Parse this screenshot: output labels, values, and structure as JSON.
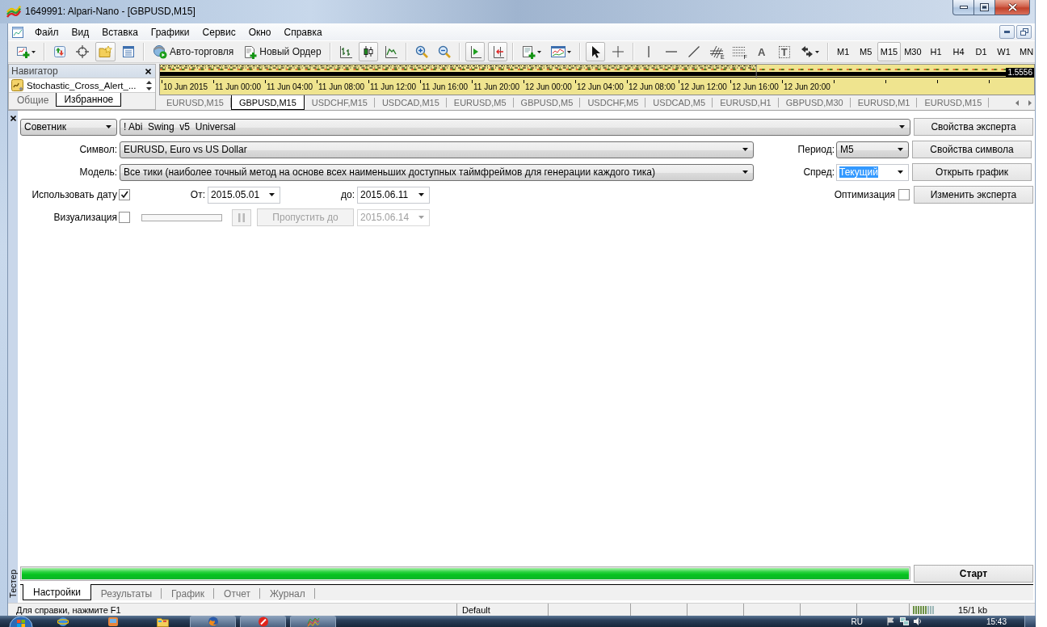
{
  "window": {
    "title": "1649991: Alpari-Nano - [GBPUSD,M15]"
  },
  "menu": [
    "Файл",
    "Вид",
    "Вставка",
    "Графики",
    "Сервис",
    "Окно",
    "Справка"
  ],
  "toolbar": {
    "groups": [
      [
        {
          "kind": "new-chart",
          "pressed": false,
          "dropdown": true
        }
      ],
      [
        {
          "kind": "market-watch",
          "pressed": false
        },
        {
          "kind": "data-window",
          "pressed": false
        },
        {
          "kind": "navigator",
          "pressed": true
        },
        {
          "kind": "terminal",
          "pressed": false
        }
      ],
      [
        {
          "kind": "auto-trading",
          "label": "Авто-торговля",
          "pressed": false
        },
        {
          "kind": "new-order",
          "label": "Новый Ордер",
          "pressed": false
        }
      ],
      [
        {
          "kind": "bar-chart",
          "pressed": false
        },
        {
          "kind": "candles",
          "pressed": true
        },
        {
          "kind": "line-chart",
          "pressed": false
        }
      ],
      [
        {
          "kind": "zoom-in",
          "pressed": false
        },
        {
          "kind": "zoom-out",
          "pressed": false
        }
      ],
      [
        {
          "kind": "autoscroll",
          "pressed": true
        },
        {
          "kind": "chart-shift",
          "pressed": true
        }
      ],
      [
        {
          "kind": "templates",
          "pressed": false,
          "dropdown": true
        },
        {
          "kind": "indicators",
          "pressed": false,
          "dropdown": true
        }
      ],
      [
        {
          "kind": "cursor",
          "pressed": true
        },
        {
          "kind": "crosshair",
          "pressed": false
        }
      ],
      [
        {
          "kind": "vline",
          "pressed": false
        },
        {
          "kind": "hline",
          "pressed": false
        },
        {
          "kind": "trendline",
          "pressed": false
        },
        {
          "kind": "channel",
          "sub": "E",
          "pressed": false
        },
        {
          "kind": "fibo",
          "sub": "F",
          "pressed": false
        },
        {
          "kind": "text",
          "label": "A",
          "pressed": false
        },
        {
          "kind": "text-label",
          "label": "T",
          "pressed": false
        },
        {
          "kind": "arrows",
          "pressed": false,
          "dropdown": true
        }
      ]
    ],
    "periods": [
      {
        "label": "M1",
        "selected": false
      },
      {
        "label": "M5",
        "selected": false
      },
      {
        "label": "M15",
        "selected": true
      },
      {
        "label": "M30",
        "selected": false
      },
      {
        "label": "H1",
        "selected": false
      },
      {
        "label": "H4",
        "selected": false
      },
      {
        "label": "D1",
        "selected": false
      },
      {
        "label": "W1",
        "selected": false
      },
      {
        "label": "MN",
        "selected": false
      }
    ]
  },
  "navigator": {
    "title": "Навигатор",
    "item": "Stochastic_Cross_Alert_...",
    "tabs": [
      {
        "label": "Общие",
        "selected": false
      },
      {
        "label": "Избранное",
        "selected": true
      }
    ]
  },
  "chart": {
    "time_labels": [
      "10 Jun 2015",
      "11 Jun 00:00",
      "11 Jun 04:00",
      "11 Jun 08:00",
      "11 Jun 12:00",
      "11 Jun 16:00",
      "11 Jun 20:00",
      "12 Jun 00:00",
      "12 Jun 04:00",
      "12 Jun 08:00",
      "12 Jun 12:00",
      "12 Jun 16:00",
      "12 Jun 20:00"
    ],
    "price": "1.5556"
  },
  "chart_tabs": [
    {
      "label": "EURUSD,M15",
      "selected": false
    },
    {
      "label": "GBPUSD,M15",
      "selected": true
    },
    {
      "label": "USDCHF,M15",
      "selected": false
    },
    {
      "label": "USDCAD,M15",
      "selected": false
    },
    {
      "label": "EURUSD,M5",
      "selected": false
    },
    {
      "label": "GBPUSD,M5",
      "selected": false
    },
    {
      "label": "USDCHF,M5",
      "selected": false
    },
    {
      "label": "USDCAD,M5",
      "selected": false
    },
    {
      "label": "EURUSD,H1",
      "selected": false
    },
    {
      "label": "GBPUSD,M30",
      "selected": false
    },
    {
      "label": "EURUSD,M1",
      "selected": false
    },
    {
      "label": "EURUSD,M15",
      "selected": false
    }
  ],
  "tester": {
    "mode_select": "Советник",
    "expert_select": "! Abi  Swing  v5  Universal",
    "expert_properties_button": "Свойства эксперта",
    "symbol": {
      "label": "Символ:",
      "value": "EURUSD, Euro vs US Dollar"
    },
    "period": {
      "label": "Период:",
      "value": "M5"
    },
    "symbol_properties_button": "Свойства символа",
    "model": {
      "label": "Модель:",
      "value": "Все тики (наиболее точный метод на основе всех наименьших доступных таймфреймов для генерации каждого тика)"
    },
    "spread": {
      "label": "Спред:",
      "value": "Текущий",
      "text_selected": true
    },
    "open_chart_button": "Открыть график",
    "use_date": {
      "label": "Использовать дату",
      "checked": true
    },
    "date_from": {
      "label": "От:",
      "value": "2015.05.01"
    },
    "date_to": {
      "label": "до:",
      "value": "2015.06.11"
    },
    "optimization": {
      "label": "Оптимизация",
      "checked": false
    },
    "modify_expert_button": "Изменить эксперта",
    "visualization": {
      "label": "Визуализация",
      "checked": false
    },
    "pause_button": {
      "disabled": true
    },
    "skip_to_button": {
      "label": "Пропустить до",
      "disabled": true
    },
    "skip_to_date": {
      "value": "2015.06.14",
      "disabled": true
    },
    "progress": {
      "level": 1
    },
    "start_button": "Старт",
    "tabs": [
      {
        "label": "Настройки",
        "selected": true
      },
      {
        "label": "Результаты",
        "selected": false
      },
      {
        "label": "График",
        "selected": false
      },
      {
        "label": "Отчет",
        "selected": false
      },
      {
        "label": "Журнал",
        "selected": false
      }
    ],
    "side_label": "Тестер"
  },
  "status_bar": {
    "help": "Для справки, нажмите F1",
    "profile": "Default",
    "traffic": "15/1 kb"
  },
  "taskbar": {
    "apps": [
      {
        "kind": "browser",
        "open": false
      },
      {
        "kind": "player",
        "open": false
      },
      {
        "kind": "folder",
        "open": false
      },
      {
        "kind": "globe",
        "open": true
      },
      {
        "kind": "red-app",
        "open": true
      },
      {
        "kind": "chart-app",
        "open": true
      }
    ],
    "language": "RU",
    "clock": "15:43"
  }
}
